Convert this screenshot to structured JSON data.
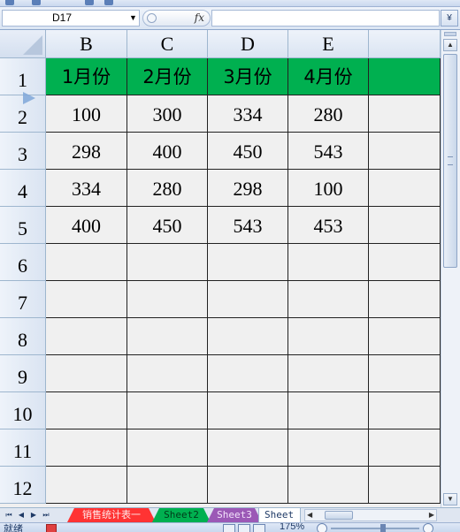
{
  "formula_bar": {
    "name_box": "D17",
    "fx_label": "fx",
    "formula": "",
    "expand_glyph": "¥"
  },
  "grid": {
    "columns": [
      "B",
      "C",
      "D",
      "E",
      ""
    ],
    "rows": [
      "1",
      "2",
      "3",
      "4",
      "5",
      "6",
      "7",
      "8",
      "9",
      "10",
      "11",
      "12"
    ],
    "header_row": [
      "1月份",
      "2月份",
      "3月份",
      "4月份",
      ""
    ],
    "data_rows": [
      [
        "100",
        "300",
        "334",
        "280",
        ""
      ],
      [
        "298",
        "400",
        "450",
        "543",
        ""
      ],
      [
        "334",
        "280",
        "298",
        "100",
        ""
      ],
      [
        "400",
        "450",
        "543",
        "453",
        ""
      ]
    ],
    "header_fill_color": "#00b050"
  },
  "sheet_tabs": {
    "nav": [
      "⏮",
      "◀",
      "▶",
      "⏭"
    ],
    "tabs": [
      {
        "label": "销售统计表一",
        "color": "#ff3333"
      },
      {
        "label": "Sheet2",
        "color": "#00b050"
      },
      {
        "label": "Sheet3",
        "color": "#9b59b6"
      },
      {
        "label": "Sheet",
        "color": "#ffffff"
      }
    ]
  },
  "status_bar": {
    "mode": "就绪",
    "zoom": "175%"
  }
}
